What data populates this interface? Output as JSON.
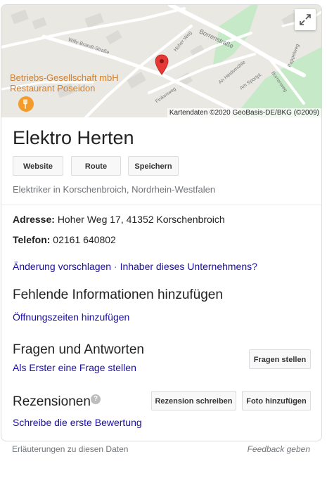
{
  "map": {
    "streets": [
      "Willy-Brandt-Straße",
      "Hoher Weg",
      "Borrenstraße",
      "An Heidsmühle",
      "Am Sportpl.",
      "Borrenweg",
      "Pappelweg",
      "Finkenweg"
    ],
    "poi_name": "Betriebs-Gesellschaft mbH Restaurant Poseidon",
    "poi_icon": "fork-knife-icon",
    "attribution": "Kartendaten ©2020 GeoBasis-DE/BKG (©2009)",
    "expand_icon": "expand-icon",
    "pin_color": "#e53935"
  },
  "business": {
    "name": "Elektro Herten",
    "buttons": {
      "website": "Website",
      "route": "Route",
      "save": "Speichern"
    },
    "category": "Elektriker in Korschenbroich, Nordrhein-Westfalen"
  },
  "info": {
    "address_label": "Adresse:",
    "address_value": "Hoher Weg 17, 41352 Korschenbroich",
    "phone_label": "Telefon:",
    "phone_value": "02161 640802"
  },
  "links": {
    "suggest_edit": "Änderung vorschlagen",
    "separator": "·",
    "owner": "Inhaber dieses Unternehmens?"
  },
  "missing": {
    "title": "Fehlende Informationen hinzufügen",
    "add_hours": "Öffnungszeiten hinzufügen"
  },
  "qa": {
    "title": "Fragen und Antworten",
    "ask_first": "Als Erster eine Frage stellen",
    "ask_button": "Fragen stellen"
  },
  "reviews": {
    "title": "Rezensionen",
    "write_button": "Rezension schreiben",
    "photo_button": "Foto hinzufügen",
    "write_first": "Schreibe die erste Bewertung",
    "help_icon": "?"
  },
  "footer": {
    "explanations": "Erläuterungen zu diesen Daten",
    "feedback": "Feedback geben"
  },
  "colors": {
    "link": "#1a0dab",
    "poi": "#d07f2c",
    "park": "#c6e9c8"
  }
}
